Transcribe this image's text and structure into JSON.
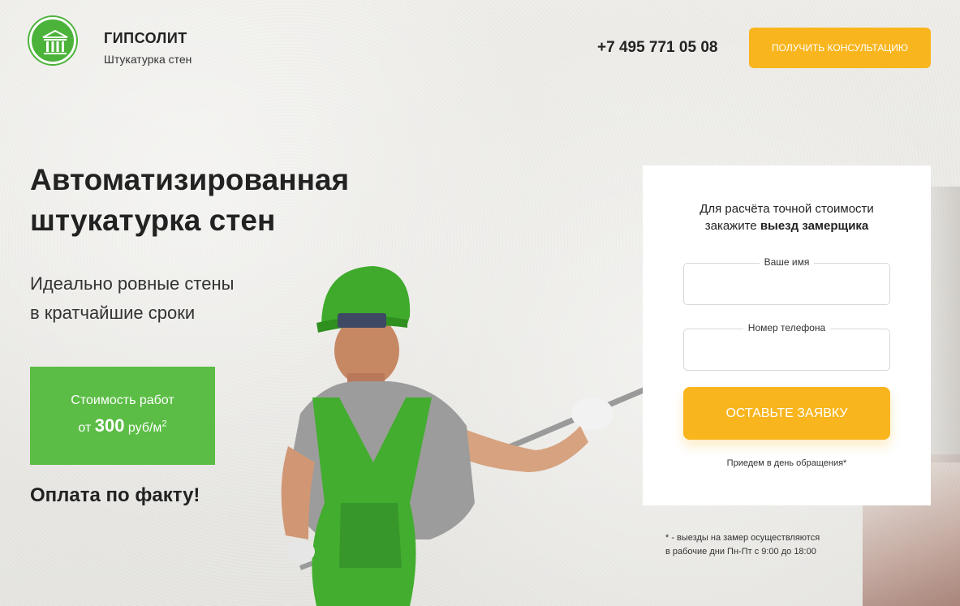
{
  "header": {
    "brand_name": "ГИПСОЛИТ",
    "brand_sub": "Штукатурка стен",
    "logo_icon": "columns-building-icon",
    "phone": "+7 495 771 05 08",
    "consult_label": "ПОЛУЧИТЬ КОНСУЛЬТАЦИЮ"
  },
  "hero": {
    "title_line1": "Автоматизированная",
    "title_line2": "штукатурка стен",
    "sub_line1": "Идеально ровные стены",
    "sub_line2": "в кратчайшие сроки",
    "price_line1": "Стоимость работ",
    "price_prefix": "от",
    "price_value": "300",
    "price_unit": "руб/м",
    "price_unit_sup": "2",
    "pay_note": "Оплата по факту!"
  },
  "form": {
    "title_line1": "Для расчёта точной стоимости",
    "title_line2_prefix": "закажите",
    "title_line2_bold": "выезд замерщика",
    "name_label": "Ваше имя",
    "name_value": "",
    "phone_label": "Номер телефона",
    "phone_value": "",
    "submit_label": "ОСТАВЬТЕ ЗАЯВКУ",
    "note": "Приедем в день обращения*"
  },
  "footnote": {
    "line1": "* - выезды на замер осуществляются",
    "line2": "в рабочие дни Пн-Пт с 9:00 до 18:00"
  },
  "colors": {
    "accent_orange": "#f8b51d",
    "accent_green": "#5bbd45",
    "logo_green": "#4cb33a"
  }
}
